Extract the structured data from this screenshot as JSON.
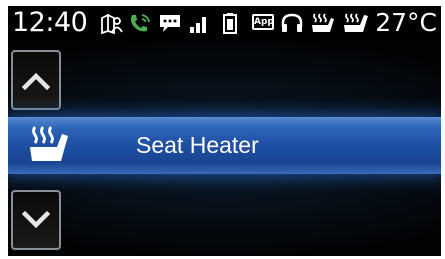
{
  "status_bar": {
    "time": "12:40",
    "temperature": "27°C",
    "app_badge": "App",
    "icons": [
      "phonebook-icon",
      "phone-call-icon",
      "message-icon",
      "signal-bars-icon",
      "battery-icon",
      "app-icon",
      "headphones-icon",
      "seat-heater-icon",
      "seat-heater-alt-icon"
    ]
  },
  "menu": {
    "up_icon": "chevron-up-icon",
    "down_icon": "chevron-down-icon",
    "selected_item": {
      "label": "Seat Heater",
      "icon": "seat-heater-icon"
    }
  },
  "colors": {
    "highlight": "#1e4fa3",
    "background": "#000000",
    "text": "#ffffff",
    "call_green": "#4caf50"
  }
}
